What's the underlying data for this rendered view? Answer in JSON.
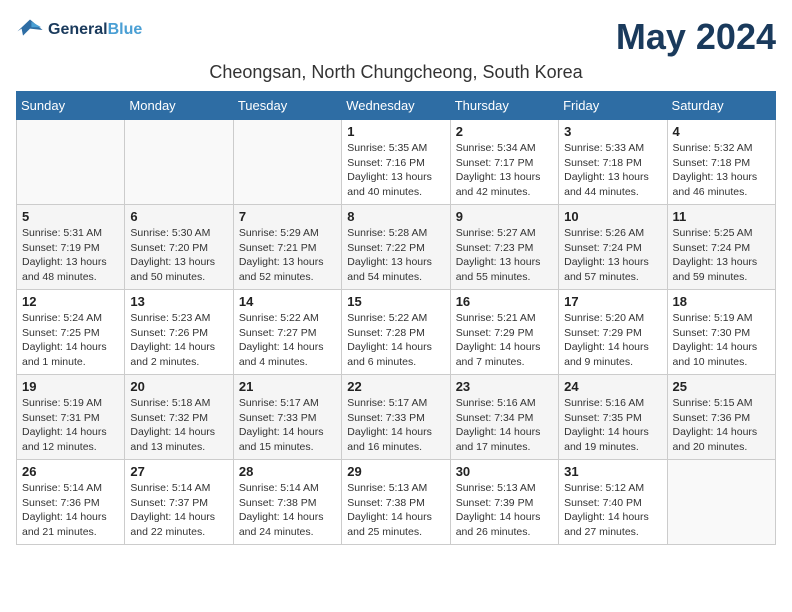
{
  "header": {
    "logo_line1": "General",
    "logo_line2": "Blue",
    "month_year": "May 2024",
    "location": "Cheongsan, North Chungcheong, South Korea"
  },
  "weekdays": [
    "Sunday",
    "Monday",
    "Tuesday",
    "Wednesday",
    "Thursday",
    "Friday",
    "Saturday"
  ],
  "weeks": [
    [
      {
        "day": "",
        "info": ""
      },
      {
        "day": "",
        "info": ""
      },
      {
        "day": "",
        "info": ""
      },
      {
        "day": "1",
        "info": "Sunrise: 5:35 AM\nSunset: 7:16 PM\nDaylight: 13 hours\nand 40 minutes."
      },
      {
        "day": "2",
        "info": "Sunrise: 5:34 AM\nSunset: 7:17 PM\nDaylight: 13 hours\nand 42 minutes."
      },
      {
        "day": "3",
        "info": "Sunrise: 5:33 AM\nSunset: 7:18 PM\nDaylight: 13 hours\nand 44 minutes."
      },
      {
        "day": "4",
        "info": "Sunrise: 5:32 AM\nSunset: 7:18 PM\nDaylight: 13 hours\nand 46 minutes."
      }
    ],
    [
      {
        "day": "5",
        "info": "Sunrise: 5:31 AM\nSunset: 7:19 PM\nDaylight: 13 hours\nand 48 minutes."
      },
      {
        "day": "6",
        "info": "Sunrise: 5:30 AM\nSunset: 7:20 PM\nDaylight: 13 hours\nand 50 minutes."
      },
      {
        "day": "7",
        "info": "Sunrise: 5:29 AM\nSunset: 7:21 PM\nDaylight: 13 hours\nand 52 minutes."
      },
      {
        "day": "8",
        "info": "Sunrise: 5:28 AM\nSunset: 7:22 PM\nDaylight: 13 hours\nand 54 minutes."
      },
      {
        "day": "9",
        "info": "Sunrise: 5:27 AM\nSunset: 7:23 PM\nDaylight: 13 hours\nand 55 minutes."
      },
      {
        "day": "10",
        "info": "Sunrise: 5:26 AM\nSunset: 7:24 PM\nDaylight: 13 hours\nand 57 minutes."
      },
      {
        "day": "11",
        "info": "Sunrise: 5:25 AM\nSunset: 7:24 PM\nDaylight: 13 hours\nand 59 minutes."
      }
    ],
    [
      {
        "day": "12",
        "info": "Sunrise: 5:24 AM\nSunset: 7:25 PM\nDaylight: 14 hours\nand 1 minute."
      },
      {
        "day": "13",
        "info": "Sunrise: 5:23 AM\nSunset: 7:26 PM\nDaylight: 14 hours\nand 2 minutes."
      },
      {
        "day": "14",
        "info": "Sunrise: 5:22 AM\nSunset: 7:27 PM\nDaylight: 14 hours\nand 4 minutes."
      },
      {
        "day": "15",
        "info": "Sunrise: 5:22 AM\nSunset: 7:28 PM\nDaylight: 14 hours\nand 6 minutes."
      },
      {
        "day": "16",
        "info": "Sunrise: 5:21 AM\nSunset: 7:29 PM\nDaylight: 14 hours\nand 7 minutes."
      },
      {
        "day": "17",
        "info": "Sunrise: 5:20 AM\nSunset: 7:29 PM\nDaylight: 14 hours\nand 9 minutes."
      },
      {
        "day": "18",
        "info": "Sunrise: 5:19 AM\nSunset: 7:30 PM\nDaylight: 14 hours\nand 10 minutes."
      }
    ],
    [
      {
        "day": "19",
        "info": "Sunrise: 5:19 AM\nSunset: 7:31 PM\nDaylight: 14 hours\nand 12 minutes."
      },
      {
        "day": "20",
        "info": "Sunrise: 5:18 AM\nSunset: 7:32 PM\nDaylight: 14 hours\nand 13 minutes."
      },
      {
        "day": "21",
        "info": "Sunrise: 5:17 AM\nSunset: 7:33 PM\nDaylight: 14 hours\nand 15 minutes."
      },
      {
        "day": "22",
        "info": "Sunrise: 5:17 AM\nSunset: 7:33 PM\nDaylight: 14 hours\nand 16 minutes."
      },
      {
        "day": "23",
        "info": "Sunrise: 5:16 AM\nSunset: 7:34 PM\nDaylight: 14 hours\nand 17 minutes."
      },
      {
        "day": "24",
        "info": "Sunrise: 5:16 AM\nSunset: 7:35 PM\nDaylight: 14 hours\nand 19 minutes."
      },
      {
        "day": "25",
        "info": "Sunrise: 5:15 AM\nSunset: 7:36 PM\nDaylight: 14 hours\nand 20 minutes."
      }
    ],
    [
      {
        "day": "26",
        "info": "Sunrise: 5:14 AM\nSunset: 7:36 PM\nDaylight: 14 hours\nand 21 minutes."
      },
      {
        "day": "27",
        "info": "Sunrise: 5:14 AM\nSunset: 7:37 PM\nDaylight: 14 hours\nand 22 minutes."
      },
      {
        "day": "28",
        "info": "Sunrise: 5:14 AM\nSunset: 7:38 PM\nDaylight: 14 hours\nand 24 minutes."
      },
      {
        "day": "29",
        "info": "Sunrise: 5:13 AM\nSunset: 7:38 PM\nDaylight: 14 hours\nand 25 minutes."
      },
      {
        "day": "30",
        "info": "Sunrise: 5:13 AM\nSunset: 7:39 PM\nDaylight: 14 hours\nand 26 minutes."
      },
      {
        "day": "31",
        "info": "Sunrise: 5:12 AM\nSunset: 7:40 PM\nDaylight: 14 hours\nand 27 minutes."
      },
      {
        "day": "",
        "info": ""
      }
    ]
  ]
}
